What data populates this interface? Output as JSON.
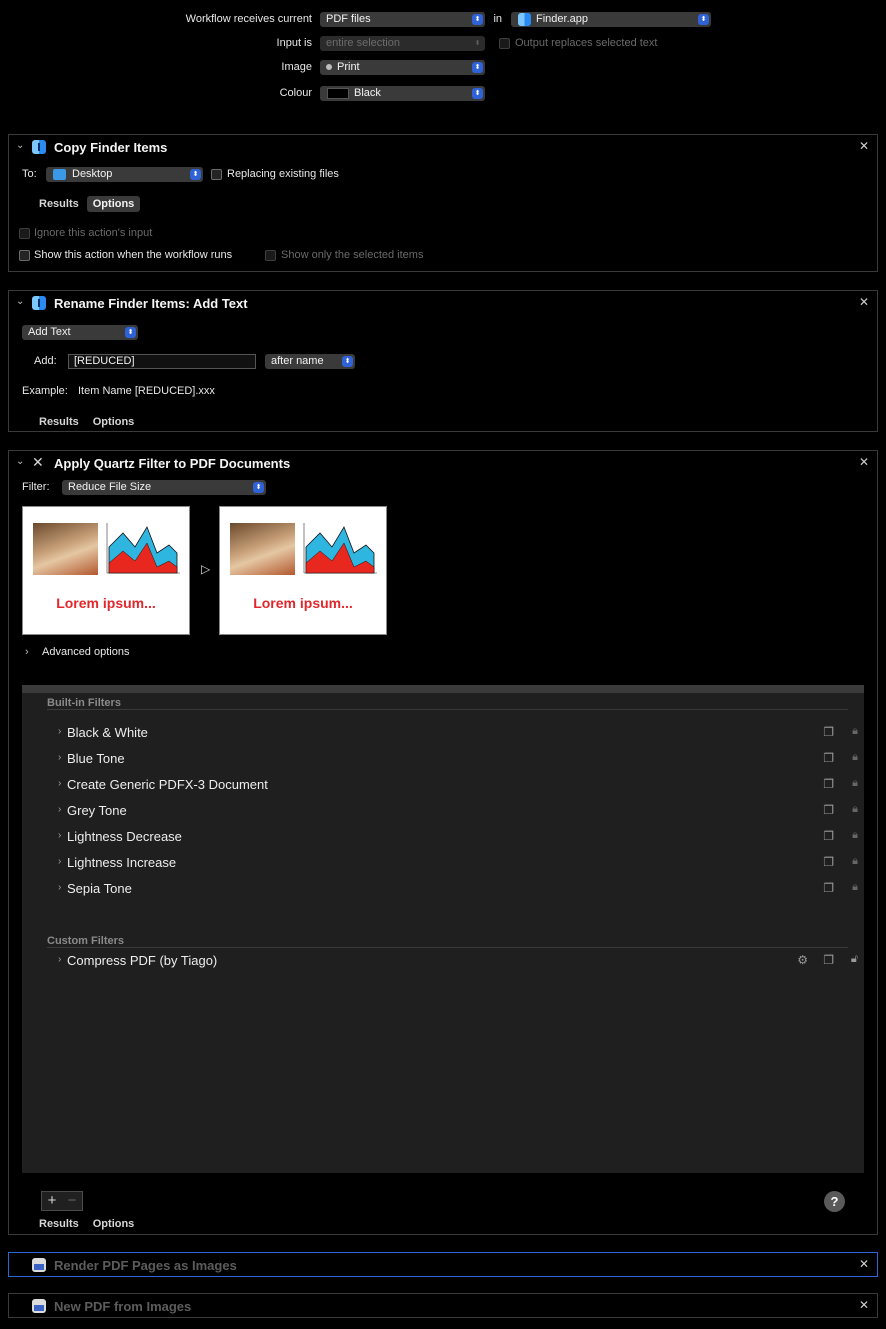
{
  "workflow": {
    "receives_label": "Workflow receives current",
    "receives_value": "PDF files",
    "in_label": "in",
    "app_value": "Finder.app",
    "input_is_label": "Input is",
    "input_is_value": "entire selection",
    "output_replaces_label": "Output replaces selected text",
    "image_label": "Image",
    "image_value": "Print",
    "colour_label": "Colour",
    "colour_value": "Black"
  },
  "copy_action": {
    "title": "Copy Finder Items",
    "to_label": "To:",
    "to_value": "Desktop",
    "replacing_label": "Replacing existing files",
    "tab_results": "Results",
    "tab_options": "Options",
    "ignore_input_label": "Ignore this action's input",
    "show_action_label": "Show this action when the workflow runs",
    "show_selected_label": "Show only the selected items"
  },
  "rename_action": {
    "title": "Rename Finder Items: Add Text",
    "mode_value": "Add Text",
    "add_label": "Add:",
    "add_value": "[REDUCED]",
    "position_value": "after name",
    "example_label": "Example:",
    "example_value": "Item Name [REDUCED].xxx",
    "tab_results": "Results",
    "tab_options": "Options"
  },
  "quartz_action": {
    "title": "Apply Quartz Filter to PDF Documents",
    "filter_label": "Filter:",
    "filter_value": "Reduce File Size",
    "preview_text": "Lorem ipsum...",
    "advanced_label": "Advanced options",
    "builtin_header": "Built-in Filters",
    "builtin_filters": [
      "Black & White",
      "Blue Tone",
      "Create Generic PDFX-3 Document",
      "Grey Tone",
      "Lightness Decrease",
      "Lightness Increase",
      "Sepia Tone"
    ],
    "custom_header": "Custom Filters",
    "custom_filters": [
      "Compress PDF (by Tiago)"
    ],
    "tab_results": "Results",
    "tab_options": "Options",
    "help_label": "?"
  },
  "render_action": {
    "title": "Render PDF Pages as Images"
  },
  "newpdf_action": {
    "title": "New PDF from Images"
  }
}
